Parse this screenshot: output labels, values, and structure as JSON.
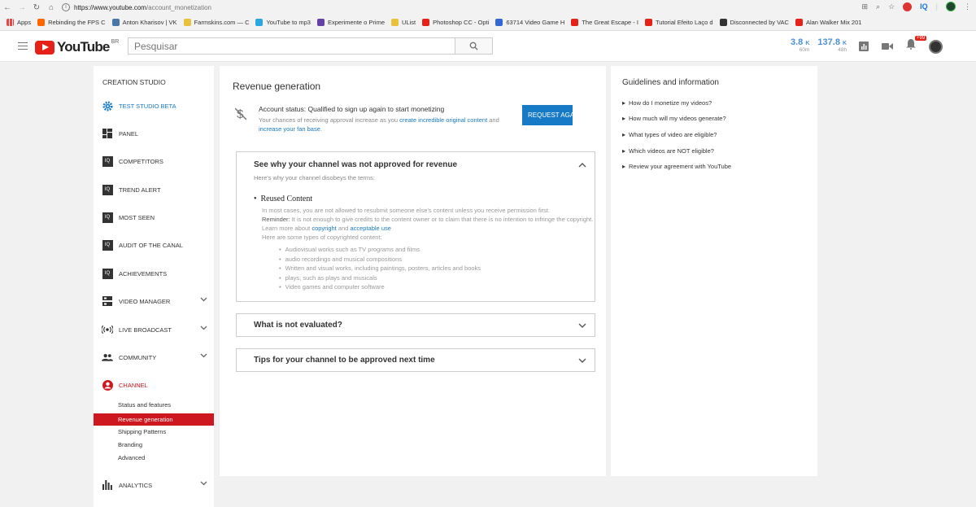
{
  "browser": {
    "url_host": "https://www.youtube.com",
    "url_path": "/account_monetization",
    "bookmarks": [
      {
        "label": "Apps",
        "color": "#e44"
      },
      {
        "label": "Rebinding the FPS C",
        "color": "#f60"
      },
      {
        "label": "Anton Kharisov | VK",
        "color": "#4a76a8"
      },
      {
        "label": "Farmskins.com — C",
        "color": "#e8c23a"
      },
      {
        "label": "YouTube to mp3",
        "color": "#2aa6e0"
      },
      {
        "label": "Experimente o Prime",
        "color": "#6441a5"
      },
      {
        "label": "UList",
        "color": "#e8c23a"
      },
      {
        "label": "Photoshop CC - Opti",
        "color": "#e62117"
      },
      {
        "label": "63714 Video Game H",
        "color": "#3367d6"
      },
      {
        "label": "The Great Escape - I",
        "color": "#e62117"
      },
      {
        "label": "Tutorial Efeito Laço d",
        "color": "#e62117"
      },
      {
        "label": "Disconnected by VAC",
        "color": "#333"
      },
      {
        "label": "Alan Walker Mix 201",
        "color": "#e62117"
      }
    ],
    "ext_iq": "IQ"
  },
  "masthead": {
    "logo_text": "YouTube",
    "region": "BR",
    "search_placeholder": "Pesquisar",
    "stats": [
      {
        "value": "3.8",
        "unit": "K",
        "period": "60m"
      },
      {
        "value": "137.8",
        "unit": "K",
        "period": "48h"
      }
    ],
    "notif_count": "+99"
  },
  "sidebar": {
    "title": "CREATION STUDIO",
    "items": [
      {
        "label": "TEST STUDIO BETA"
      },
      {
        "label": "PANEL"
      },
      {
        "label": "COMPETITORS"
      },
      {
        "label": "TREND ALERT"
      },
      {
        "label": "MOST SEEN"
      },
      {
        "label": "AUDIT OF THE CANAL"
      },
      {
        "label": "ACHIEVEMENTS"
      },
      {
        "label": "VIDEO MANAGER"
      },
      {
        "label": "LIVE BROADCAST"
      },
      {
        "label": "COMMUNITY"
      },
      {
        "label": "CHANNEL"
      },
      {
        "label": "ANALYTICS"
      }
    ],
    "channel_sub": [
      "Status and features",
      "Revenue generation",
      "Shipping Patterns",
      "Branding",
      "Advanced"
    ]
  },
  "main": {
    "title": "Revenue generation",
    "status_label": "Account status:",
    "status_value": "Qualified to sign up again to start monetizing",
    "desc_1": "Your chances of receiving approval increase as you",
    "desc_link1": "create incredible original content",
    "desc_2": "and",
    "desc_link2": "increase your fan base",
    "desc_3": ".",
    "request_button": "REQUEST AGAIN",
    "box1": {
      "title": "See why your channel was not approved for revenue",
      "subtitle": "Here's why your channel disobeys the terms:",
      "heading": "Reused Content",
      "body_1": "In most cases, you are not allowed to resubmit someone else's content unless you receive permission first.",
      "reminder_label": "Reminder:",
      "reminder_text": "It is not enough to give credits to the content owner or to claim that there is no intention to infringe the copyright. Learn more about",
      "link_copyright": "copyright",
      "and_text": "and",
      "link_use": "acceptable use",
      "types_intro": "Here are some types of copyrighted content:",
      "types": [
        "Audiovisual works such as TV programs and films",
        "audio recordings and musical compositions",
        "Written and visual works, including paintings, posters, articles and books",
        "plays, such as plays and musicals",
        "Video games and computer software"
      ]
    },
    "box2_title": "What is not evaluated?",
    "box3_title": "Tips for your channel to be approved next time"
  },
  "right": {
    "title": "Guidelines and information",
    "links": [
      "How do I monetize my videos?",
      "How much will my videos generate?",
      "What types of video are eligible?",
      "Which videos are NOT eligible?",
      "Review your agreement with YouTube"
    ]
  }
}
